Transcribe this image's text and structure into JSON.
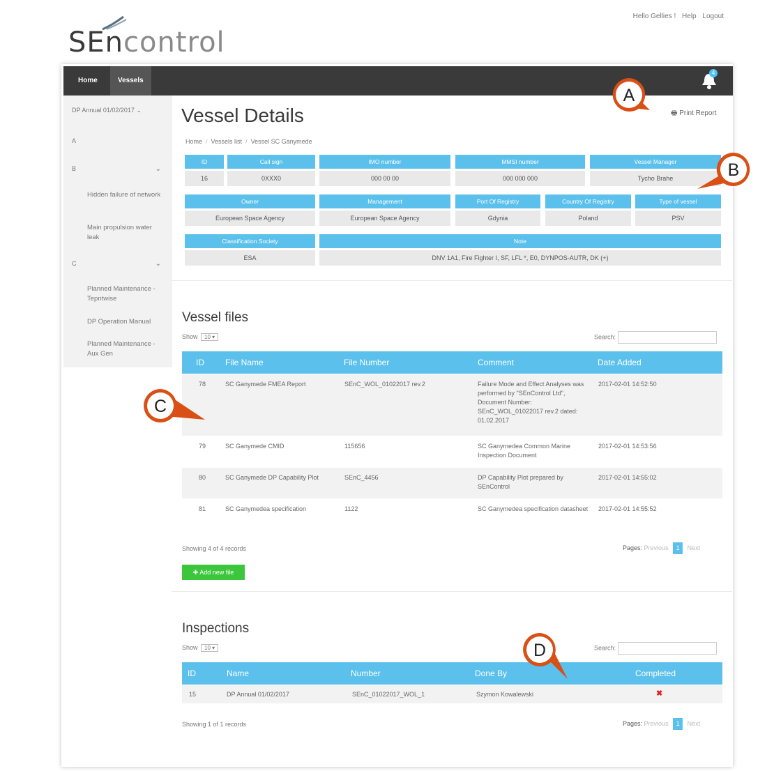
{
  "toplinks": {
    "greeting": "Hello Gellies !",
    "help": "Help",
    "logout": "Logout"
  },
  "logo": {
    "part1": "SEn",
    "part2": "control"
  },
  "nav": {
    "home": "Home",
    "vessels": "Vessels",
    "badge": "4"
  },
  "sidebar": {
    "select": "DP Annual 01/02/2017",
    "groups": [
      {
        "label": "A"
      },
      {
        "label": "B",
        "items": [
          "Hidden failure of network",
          "Main propulsion water leak"
        ]
      },
      {
        "label": "C",
        "items": [
          "Planned Maintenance - Tepntwise",
          "DP Operation Manual",
          "Planned Maintenance - Aux Gen"
        ]
      }
    ]
  },
  "page": {
    "title": "Vessel Details",
    "print": "Print Report",
    "breadcrumb": [
      "Home",
      "Vessels list",
      "Vessel SC Ganymede"
    ]
  },
  "details": {
    "row1": [
      {
        "h": "ID",
        "v": "16"
      },
      {
        "h": "Call sign",
        "v": "0XXX0"
      },
      {
        "h": "IMO number",
        "v": "000 00 00"
      },
      {
        "h": "MMSI number",
        "v": "000 000 000"
      },
      {
        "h": "Vessel Manager",
        "v": "Tycho Brahe"
      }
    ],
    "row2": [
      {
        "h": "Owner",
        "v": "European Space Agency"
      },
      {
        "h": "Management",
        "v": "European Space Agency"
      },
      {
        "h": "Port Of Registry",
        "v": "Gdynia"
      },
      {
        "h": "Country Of Registry",
        "v": "Poland"
      },
      {
        "h": "Type of vessel",
        "v": "PSV"
      }
    ],
    "row3": [
      {
        "h": "Classification Society",
        "v": "ESA"
      },
      {
        "h": "Note",
        "v": "DNV 1A1, Fire Fighter I, SF, LFL *, E0, DYNPOS-AUTR, DK (+)"
      }
    ]
  },
  "files": {
    "title": "Vessel files",
    "show_label": "Show",
    "show_value": "10",
    "search_label": "Search:",
    "columns": [
      "ID",
      "File Name",
      "File Number",
      "Comment",
      "Date Added"
    ],
    "rows": [
      [
        "78",
        "SC Ganymede FMEA Report",
        "SEnC_WOL_01022017 rev.2",
        "Failure Mode and Effect Analyses was performed by \"SEnControl Ltd\", Document Number: SEnC_WOL_01022017 rev.2 dated: 01.02.2017",
        "2017-02-01 14:52:50"
      ],
      [
        "79",
        "SC Ganymede CMID",
        "115656",
        "SC Ganymedea Common Marine Inspection Document",
        "2017-02-01 14:53:56"
      ],
      [
        "80",
        "SC Ganymede DP Capability Plot",
        "SEnC_4456",
        "DP Capability Plot prepared by SEnControl",
        "2017-02-01 14:55:02"
      ],
      [
        "81",
        "SC Ganymedea specification",
        "1122",
        "SC Ganymedea specification datasheet",
        "2017-02-01 14:55:52"
      ]
    ],
    "info": "Showing 4 of 4 records",
    "pages_label": "Pages:",
    "prev": "Previous",
    "page": "1",
    "next": "Next",
    "add_button": "Add new file"
  },
  "inspections": {
    "title": "Inspections",
    "show_label": "Show",
    "show_value": "10",
    "search_label": "Search:",
    "columns": [
      "ID",
      "Name",
      "Number",
      "Done By",
      "Completed"
    ],
    "rows": [
      [
        "15",
        "DP Annual 01/02/2017",
        "SEnC_01022017_WOL_1",
        "Szymon Kowalewski",
        "✖"
      ]
    ],
    "info": "Showing 1 of 1 records",
    "pages_label": "Pages:",
    "prev": "Previous",
    "page": "1",
    "next": "Next"
  },
  "callouts": [
    "A",
    "B",
    "C",
    "D"
  ],
  "colors": {
    "accent": "#5bc0eb",
    "navbar": "#3a3a3a",
    "callout": "#d94f14",
    "add": "#3cc63c"
  }
}
